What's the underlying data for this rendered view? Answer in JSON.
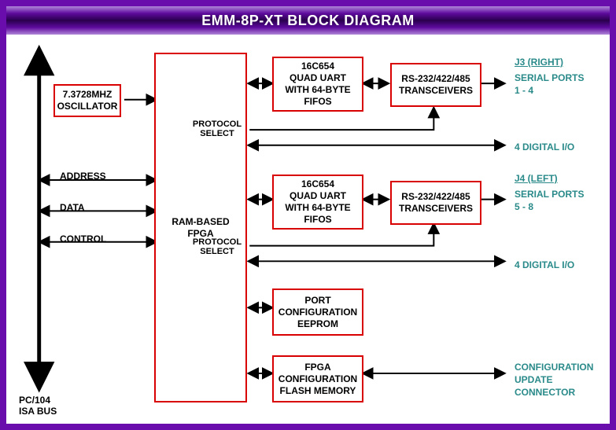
{
  "title": "EMM-8P-XT BLOCK DIAGRAM",
  "bus_label_1": "PC/104",
  "bus_label_2": "ISA BUS",
  "oscillator": "7.3728MHZ\nOSCILLATOR",
  "fpga": "RAM-BASED\nFPGA",
  "address": "ADDRESS",
  "data": "DATA",
  "control": "CONTROL",
  "protocol_select": "PROTOCOL\nSELECT",
  "uart": "16C654\nQUAD UART\nWITH 64-BYTE\nFIFOS",
  "transceivers": "RS-232/422/485\nTRANSCEIVERS",
  "port_eeprom": "PORT\nCONFIGURATION\nEEPROM",
  "fpga_flash": "FPGA\nCONFIGURATION\nFLASH MEMORY",
  "j3": "J3 (RIGHT)",
  "j4": "J4 (LEFT)",
  "serial_1_4_a": "SERIAL PORTS",
  "serial_1_4_b": "1 - 4",
  "serial_5_8_a": "SERIAL PORTS",
  "serial_5_8_b": "5 - 8",
  "digital_io": "4 DIGITAL I/O",
  "config_conn_1": "CONFIGURATION",
  "config_conn_2": "UPDATE",
  "config_conn_3": "CONNECTOR"
}
